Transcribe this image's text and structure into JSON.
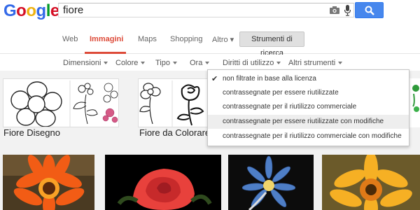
{
  "logo": {
    "letters": [
      {
        "ch": "G",
        "color": "#3369e8"
      },
      {
        "ch": "o",
        "color": "#d50f25"
      },
      {
        "ch": "o",
        "color": "#eeb211"
      },
      {
        "ch": "g",
        "color": "#3369e8"
      },
      {
        "ch": "l",
        "color": "#009925"
      },
      {
        "ch": "e",
        "color": "#d50f25"
      }
    ]
  },
  "search": {
    "value": "fiore"
  },
  "tabs": {
    "web": "Web",
    "images": "Immagini",
    "maps": "Maps",
    "shopping": "Shopping",
    "more": "Altro ▾",
    "tools": "Strumenti di ricerca"
  },
  "tools": {
    "size": "Dimensioni",
    "color": "Colore",
    "type": "Tipo",
    "time": "Ora",
    "rights": "Diritti di utilizzo",
    "more": "Altri strumenti"
  },
  "menu": {
    "items": [
      "non filtrate in base alla licenza",
      "contrassegnate per essere riutilizzate",
      "contrassegnate per il riutilizzo commerciale",
      "contrassegnate per essere riutilizzate con modifiche",
      "contrassegnate per il riutilizzo commerciale con modifiche"
    ],
    "selected_index": 0,
    "hover_index": 3
  },
  "results": {
    "captions": [
      "Fiore Disegno",
      "Fiore da Colorare"
    ]
  },
  "colors": {
    "accent_red": "#dd4b39",
    "search_blue": "#4787ed",
    "content_bg": "#f2f2f2"
  }
}
